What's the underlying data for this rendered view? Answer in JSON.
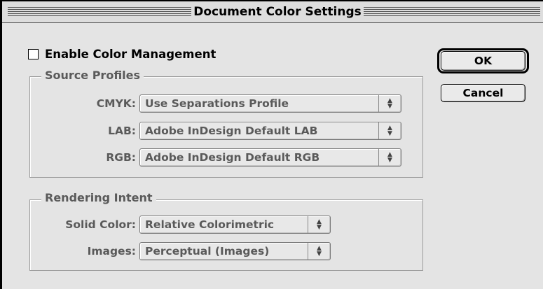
{
  "dialog": {
    "title": "Document Color Settings"
  },
  "color_management": {
    "label": "Enable Color Management",
    "checked": false
  },
  "source_profiles": {
    "title": "Source Profiles",
    "rows": [
      {
        "label": "CMYK:",
        "value": "Use Separations Profile"
      },
      {
        "label": "LAB:",
        "value": "Adobe InDesign Default LAB"
      },
      {
        "label": "RGB:",
        "value": "Adobe InDesign Default RGB"
      }
    ]
  },
  "rendering_intent": {
    "title": "Rendering Intent",
    "rows": [
      {
        "label": "Solid Color:",
        "value": "Relative Colorimetric"
      },
      {
        "label": "Images:",
        "value": "Perceptual (Images)"
      }
    ]
  },
  "buttons": {
    "ok": "OK",
    "cancel": "Cancel"
  },
  "icons": {
    "popup_arrow": "updown-arrows-icon",
    "checkbox": "checkbox-icon"
  },
  "colors": {
    "dialog_bg": "#e4e4e4",
    "disabled_text": "#5a5a5a",
    "border": "#000000"
  }
}
